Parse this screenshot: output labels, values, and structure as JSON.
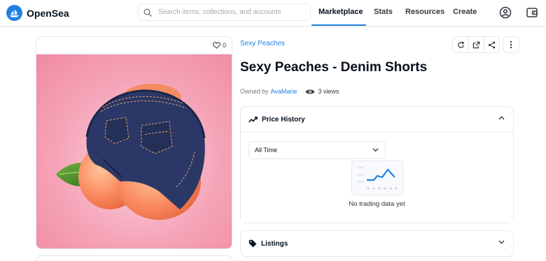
{
  "header": {
    "brand": "OpenSea",
    "search_placeholder": "Search items, collections, and accounts",
    "nav": [
      "Marketplace",
      "Stats",
      "Resources",
      "Create"
    ],
    "active_nav": "Marketplace",
    "accent_color": "#2081e2"
  },
  "item": {
    "favorites": "0",
    "collection": "Sexy Peaches",
    "title": "Sexy Peaches - Denim Shorts",
    "owned_by_label": "Owned by",
    "owner": "AvaMarie",
    "views": "3 views"
  },
  "price_history": {
    "title": "Price History",
    "period": "All Time",
    "empty": "No trading data yet"
  },
  "listings": {
    "title": "Listings"
  },
  "icons": [
    "search-icon",
    "account-icon",
    "wallet-icon",
    "heart-icon",
    "refresh-icon",
    "external-link-icon",
    "share-icon",
    "more-icon",
    "eye-icon",
    "trend-icon",
    "tag-icon",
    "chevron-up-icon",
    "chevron-down-icon"
  ]
}
